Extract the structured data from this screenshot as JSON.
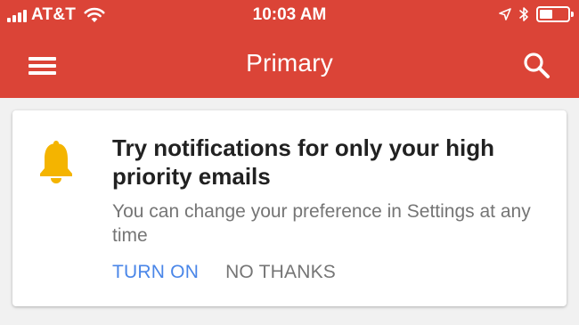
{
  "status_bar": {
    "carrier": "AT&T",
    "time": "10:03 AM"
  },
  "app_bar": {
    "title": "Primary",
    "background_color": "#db4437",
    "menu_icon": "hamburger-menu-icon",
    "search_icon": "search-icon"
  },
  "notification_card": {
    "icon": "bell-icon",
    "icon_color": "#f4b400",
    "title": "Try notifications for only your high priority emails",
    "subtitle": "You can change your preference in Settings at any time",
    "primary_action": "TURN ON",
    "secondary_action": "NO THANKS",
    "primary_action_color": "#4a86e8"
  }
}
